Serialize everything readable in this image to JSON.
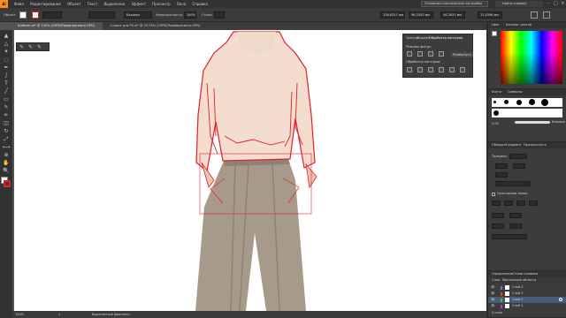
{
  "menu": {
    "items": [
      "Файл",
      "Редактирование",
      "Объект",
      "Текст",
      "Выделение",
      "Эффект",
      "Просмотр",
      "Окно",
      "Справка"
    ],
    "workspace": "Основные классические настройки",
    "search_placeholder": "Найти справку"
  },
  "control_bar": {
    "selection_label": "Объект",
    "stroke_style_label": "Базовая",
    "opacity_label": "Непрозрачность:",
    "opacity_value": "100%",
    "style_label": "Стиль:",
    "x_value": "126,6321 мм",
    "y_value": "96,3303 мм",
    "w_value": "46,2631 мм",
    "h_value": "11,0396 мм"
  },
  "tabs": [
    {
      "label": "Шаблон.ai* @ 150% (CMYK/Предпросмотр GPU)",
      "active": true
    },
    {
      "label": "1 кросс для PS.ai* @ 25,35% (CMYK/Предпросмотр GPU)",
      "active": false
    }
  ],
  "status": {
    "zoom": "150%",
    "page": "1",
    "mode": "Выделенный фрагмент"
  },
  "float_panel": {
    "tabs": [
      "Трансф",
      "Выравн",
      "Обработка контуров"
    ],
    "section1": "Режимы фигур:",
    "expand_label": "Развернуть",
    "section2": "Обработка контуров:"
  },
  "right_dock": {
    "color_tabs": [
      "Цвет",
      "Каталог цветов"
    ],
    "brush_tabs": [
      "Кисти",
      "Символы"
    ],
    "brush_size_label": "5,00",
    "brush_base_label": "Базовая",
    "stroke_tabs": [
      "Обводка",
      "Градиент",
      "Прозрачность"
    ],
    "stroke_weight_label": "Толщина:",
    "stroke_dashed_label": "Пунктирная линия",
    "layers_tabs": [
      "Оформление",
      "Стили графики"
    ],
    "layers_subtabs": [
      "Слои",
      "Монтажные области"
    ],
    "layers": [
      {
        "name": "Слой 4",
        "color": "#4a7dff",
        "selected": false
      },
      {
        "name": "Слой 3",
        "color": "#ff3c3c",
        "selected": false
      },
      {
        "name": "Слой 2",
        "color": "#3cc83c",
        "selected": true
      },
      {
        "name": "Слой 1",
        "color": "#c83cc8",
        "selected": false
      }
    ],
    "layers_count": "4 слоя"
  },
  "colors": {
    "selection": "#e0202a",
    "skin": "#f2d6c6",
    "pants": "#a89a8a"
  }
}
